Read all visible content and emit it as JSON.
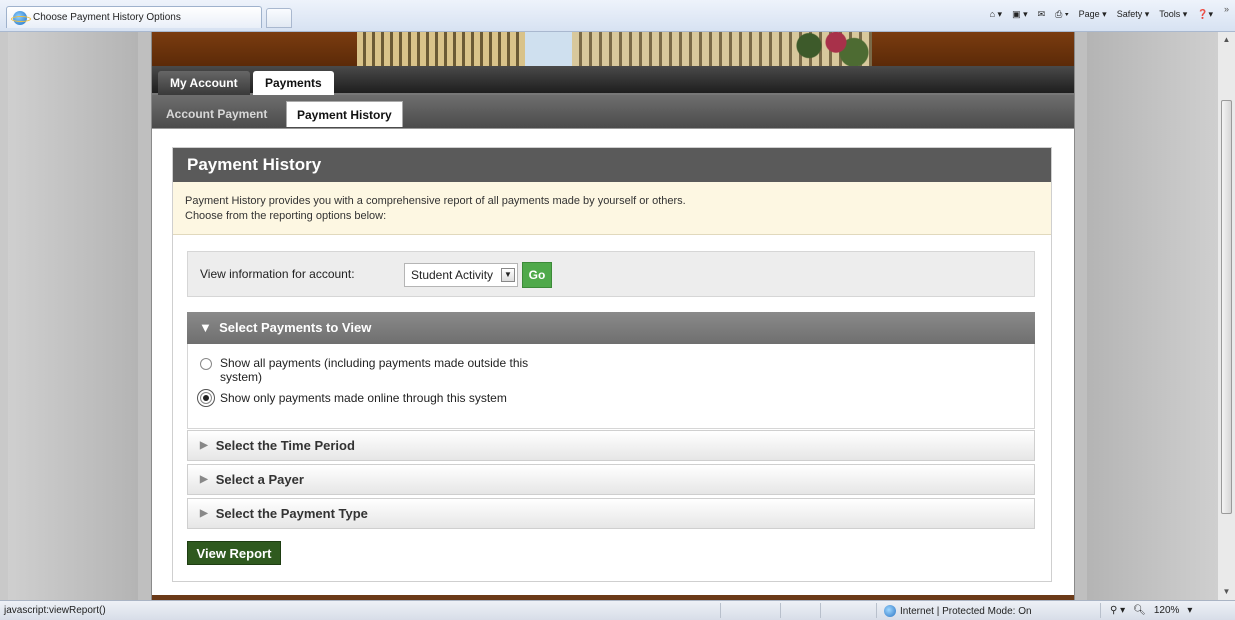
{
  "browser": {
    "tab_title": "Choose Payment History Options",
    "commands": [
      "Page ▾",
      "Safety ▾",
      "Tools ▾"
    ],
    "overflow": "»"
  },
  "nav": {
    "primary": [
      "My Account",
      "Payments"
    ],
    "secondary": [
      "Account Payment",
      "Payment History"
    ]
  },
  "page": {
    "title": "Payment History",
    "info_line1": "Payment History provides you with a comprehensive report of all payments made by yourself or others.",
    "info_line2": "Choose from the reporting options below:",
    "account_label": "View information for account:",
    "account_value": "Student Activity",
    "go_label": "Go",
    "select_payments_header": "Select Payments to View",
    "option_all": "Show all payments (including payments made outside this system)",
    "option_online": "Show only payments made online through this system",
    "selected_option": "online",
    "accordions": [
      "Select the Time Period",
      "Select a Payer",
      "Select the Payment Type"
    ],
    "view_report_label": "View Report"
  },
  "status_bar": {
    "url": "javascript:viewReport()",
    "zone": "Internet | Protected Mode: On",
    "zoom": "120%"
  },
  "colors": {
    "title_bar": "#5a5a5a",
    "info_bg": "#fdf7e2",
    "go_button": "#4fa94a",
    "view_report_button": "#2f5a1f",
    "banner": "#7a3c10"
  }
}
